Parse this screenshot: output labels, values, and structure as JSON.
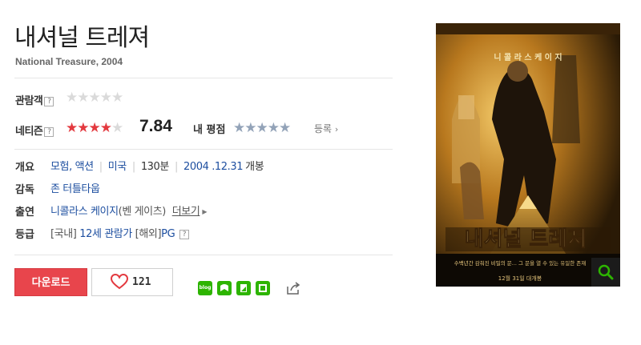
{
  "movie": {
    "title": "내셔널 트레져",
    "subtitle": "National Treasure, 2004"
  },
  "ratings": {
    "audience_label": "관람객",
    "audience_stars": "★★★★★",
    "netizen_label": "네티즌",
    "netizen_stars_filled": "★★★★",
    "netizen_stars_empty": "★",
    "netizen_score": "7.84",
    "my_rating_label": "내 평점",
    "my_rating_stars": "★★★★★",
    "register_label": "등록",
    "help_glyph": "?"
  },
  "info": {
    "overview_label": "개요",
    "genre1": "모험",
    "genre2": "액션",
    "country": "미국",
    "runtime": "130분",
    "release_date": "2004 .12.31",
    "release_suffix": "개봉",
    "director_label": "감독",
    "director": "존 터틀타웁",
    "cast_label": "출연",
    "cast_name": "니콜라스 케이지",
    "cast_role": "(벤 게이츠)",
    "cast_more": "더보기",
    "grade_label": "등급",
    "grade_domestic_prefix": "[국내]",
    "grade_domestic": "12세 관람가",
    "grade_foreign_prefix": "[해외]",
    "grade_foreign": "PG"
  },
  "actions": {
    "download_label": "다운로드",
    "like_count": "121",
    "blog_label": "blog"
  },
  "poster": {
    "top_text": "니 콜 라 스   케 이 지",
    "title_text": "내셔널 트레져",
    "bottom_text": "수백년간 감춰진 비밀의 문... 그 문을 열 수 있는 유일한 존재",
    "date_text": "12월 31일 대개봉"
  },
  "colors": {
    "accent_red": "#e8454c",
    "star_red": "#e3393f",
    "link_blue": "#1e4fa0",
    "share_green": "#2db400"
  }
}
